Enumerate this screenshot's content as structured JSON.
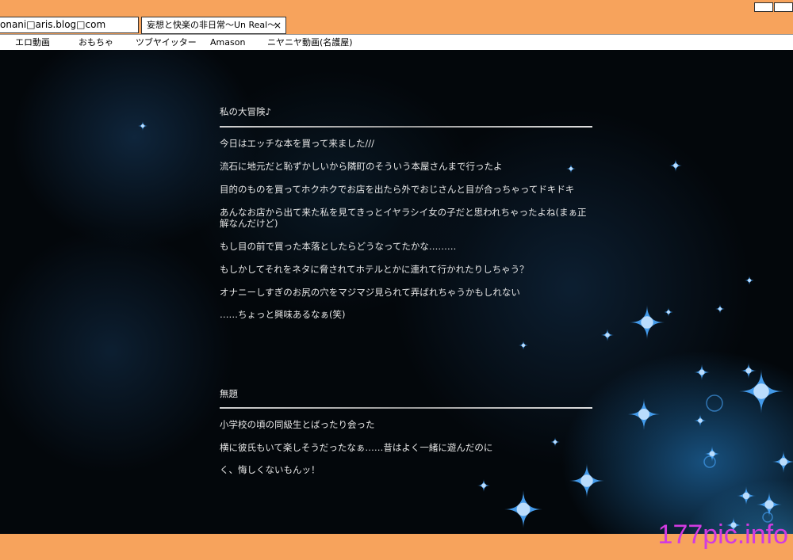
{
  "browser": {
    "address": "onani□aris.blog□com",
    "tab_title": "妄想と快楽の非日常〜Un Real〜",
    "tab_close": "×"
  },
  "bookmarks": [
    {
      "label": "エロ動画"
    },
    {
      "label": "おもちゃ"
    },
    {
      "label": "ツブヤイッター"
    },
    {
      "label": "Amason"
    },
    {
      "label": "ニヤニヤ動画(名護屋)"
    }
  ],
  "posts": [
    {
      "title": "私の大冒険♪",
      "lines": [
        " 今日はエッチな本を買って来ました///",
        "流石に地元だと恥ずかしいから隣町のそういう本屋さんまで行ったよ",
        "目的のものを買ってホクホクでお店を出たら外でおじさんと目が合っちゃってドキドキ",
        "あんなお店から出て来た私を見てきっとイヤラシイ女の子だと思われちゃったよね(まぁ正解なんだけど)",
        "もし目の前で買った本落としたらどうなってたかな………",
        "もしかしてそれをネタに脅されてホテルとかに連れて行かれたりしちゃう？",
        "オナニーしすぎのお尻の穴をマジマジ見られて弄ばれちゃうかもしれない",
        "……ちょっと興味あるなぁ(笑)"
      ]
    },
    {
      "title": "無題",
      "lines": [
        " 小学校の頃の同級生とばったり会った",
        "横に彼氏もいて楽しそうだったなぁ……昔はよく一緒に遊んだのに",
        "く、悔しくないもんッ！"
      ]
    }
  ],
  "watermark": "177pic.info",
  "colors": {
    "frame": "#f7a35c",
    "background": "#03070b",
    "text": "#e6e6e6",
    "sparkle": "#4aa8ff",
    "watermark": "#d23be0"
  }
}
